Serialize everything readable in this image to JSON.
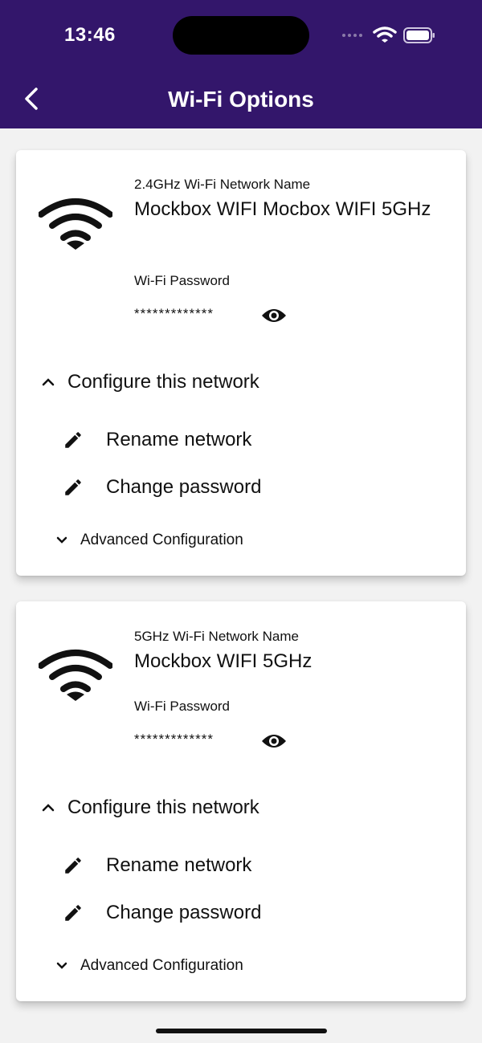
{
  "status_bar": {
    "time": "13:46"
  },
  "header": {
    "title": "Wi-Fi Options",
    "accent_color": "#33166b"
  },
  "icons": {
    "back": "chevron-left-icon",
    "wifi": "wifi-icon",
    "eye": "eye-icon",
    "edit": "pencil-icon",
    "collapse": "chevron-up-icon",
    "expand": "chevron-down-icon"
  },
  "networks": [
    {
      "band_label": "2.4GHz Wi-Fi Network Name",
      "name": "Mockbox WIFI Mocbox WIFI 5GHz",
      "password_label": "Wi-Fi Password",
      "password_masked": "*************",
      "configure_label": "Configure this network",
      "rename_label": "Rename network",
      "change_password_label": "Change password",
      "advanced_label": "Advanced Configuration"
    },
    {
      "band_label": "5GHz Wi-Fi Network Name",
      "name": "Mockbox WIFI 5GHz",
      "password_label": "Wi-Fi Password",
      "password_masked": "*************",
      "configure_label": "Configure this network",
      "rename_label": "Rename network",
      "change_password_label": "Change password",
      "advanced_label": "Advanced Configuration"
    }
  ]
}
